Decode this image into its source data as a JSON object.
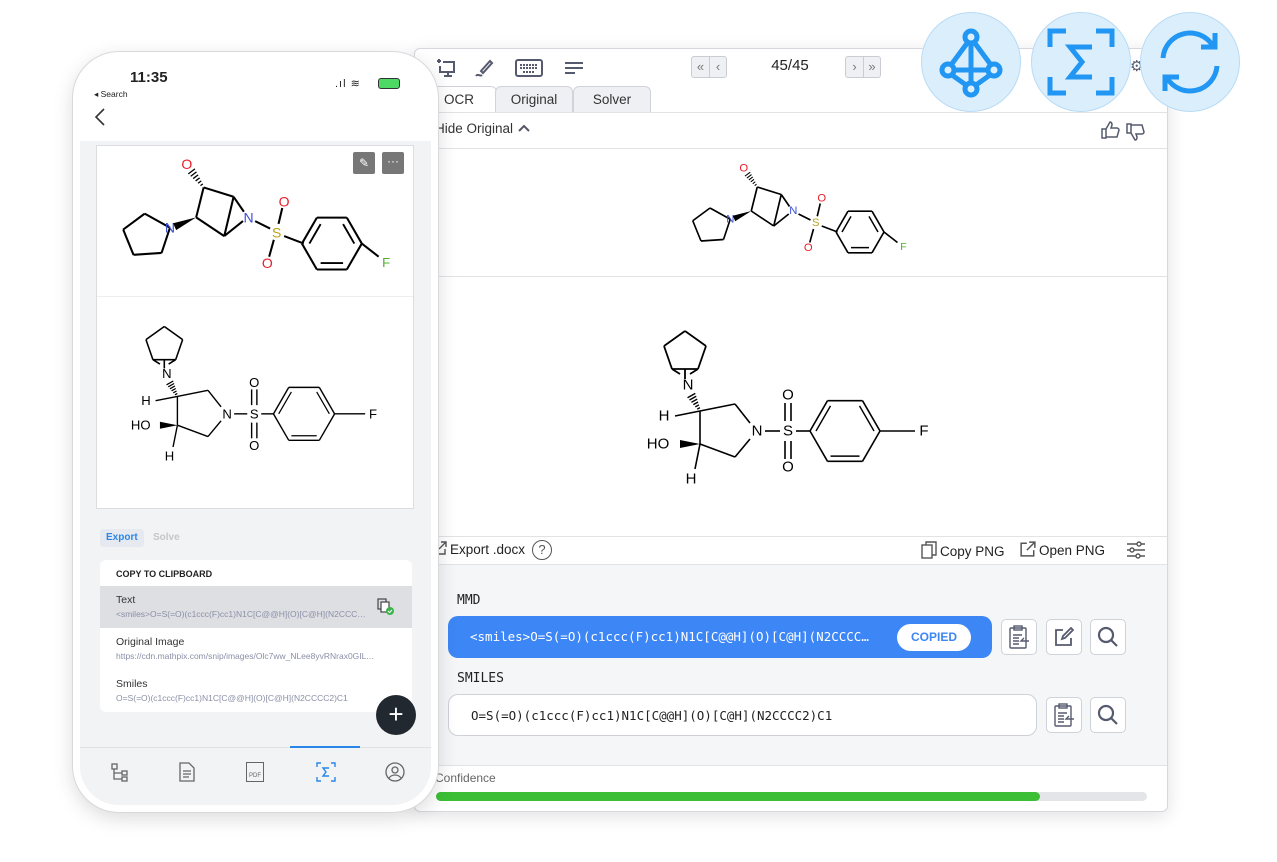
{
  "phone": {
    "time": "11:35",
    "back_app": "◂ Search",
    "tabs": {
      "export": "Export",
      "solve": "Solve"
    },
    "clipboard_header": "COPY TO CLIPBOARD",
    "items": [
      {
        "title": "Text",
        "value": "<smiles>O=S(=O)(c1ccc(F)cc1)N1C[C@@H](O)[C@H](N2CCCC2)C1</smiles>",
        "selected": true
      },
      {
        "title": "Original Image",
        "value": "https://cdn.mathpix.com/snip/images/Olc7ww_NLee8yvRNrax0GIL..."
      },
      {
        "title": "Smiles",
        "value": "O=S(=O)(c1ccc(F)cc1)N1C[C@@H](O)[C@H](N2CCCC2)C1"
      }
    ],
    "bottom_nav": [
      "tree-icon",
      "document-icon",
      "pdf-icon",
      "sigma-icon",
      "profile-icon"
    ],
    "bottom_nav_active": 3,
    "pdf_label": "PDF"
  },
  "window": {
    "page": "45/45",
    "tabs": [
      "OCR",
      "Original",
      "Solver"
    ],
    "active_tab": "OCR",
    "hide_original": "Hide Original",
    "export_docx": "Export .docx",
    "copy_png": "Copy PNG",
    "open_png": "Open PNG",
    "mmd_label": "MMD",
    "mmd_value": "<smiles>O=S(=O)(c1ccc(F)cc1)N1C[C@@H](O)[C@H](N2CCCC2)C1…",
    "copied_badge": "COPIED",
    "smiles_label": "SMILES",
    "smiles_value": "O=S(=O)(c1ccc(F)cc1)N1C[C@@H](O)[C@H](N2CCCC2)C1",
    "confidence_label": "Confidence",
    "confidence": 0.85
  },
  "feature_icons": [
    "graph-network-icon",
    "sigma-scan-icon",
    "sync-icon"
  ],
  "structure": {
    "labels": {
      "N": "N",
      "O": "O",
      "S": "S",
      "F": "F",
      "H": "H",
      "HO": "HO"
    }
  },
  "colors": {
    "accent": "#3d86f5",
    "confidence": "#3cbf37",
    "feature_icon": "#2196f3",
    "oxygen": "#e8202a",
    "nitrogen": "#3a4fd6",
    "sulfur": "#b8a21a",
    "fluorine": "#4caf2a"
  }
}
